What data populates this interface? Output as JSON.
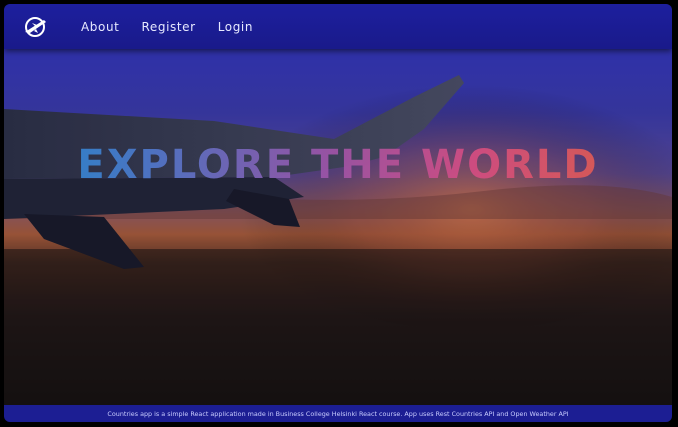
{
  "header": {
    "logo_icon": "airplane-globe-icon",
    "nav": [
      {
        "label": "About"
      },
      {
        "label": "Register"
      },
      {
        "label": "Login"
      }
    ]
  },
  "hero": {
    "title": "EXPLORE THE WORLD",
    "background": "airplane-wing-sunset-photo"
  },
  "footer": {
    "text": "Countries app is a simple React application made in Business College Helsinki React course. App uses Rest Countries API and Open Weather API"
  },
  "colors": {
    "header_bg": "#1d1f9e",
    "footer_bg": "#1c1e93",
    "title_gradient": [
      "#1f8fd2",
      "#9a55a8",
      "#d24d82",
      "#e2623e"
    ]
  }
}
